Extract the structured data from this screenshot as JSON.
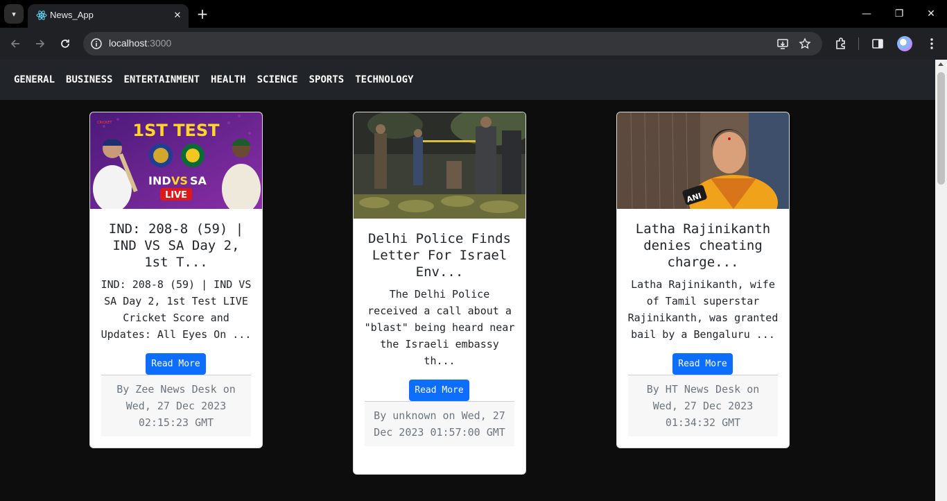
{
  "browser": {
    "tab_title": "News_App",
    "url_host": "localhost",
    "url_port": ":3000"
  },
  "nav": {
    "items": [
      "GENERAL",
      "BUSINESS",
      "ENTERTAINMENT",
      "HEALTH",
      "SCIENCE",
      "SPORTS",
      "TECHNOLOGY"
    ]
  },
  "articles": [
    {
      "title": "IND: 208-8 (59) | IND VS SA Day 2, 1st T...",
      "description": "IND: 208-8 (59) | IND VS SA Day 2, 1st Test LIVE Cricket Score and Updates: All Eyes On ...",
      "button": "Read More",
      "footer": "By Zee News Desk on Wed, 27 Dec 2023 02:15:23 GMT",
      "image": {
        "headline": "1ST TEST",
        "match_left": "IND",
        "match_vs": "VS",
        "match_right": "SA",
        "badge": "LIVE",
        "corner_logo": "CRICKET"
      }
    },
    {
      "title": "Delhi Police Finds Letter For Israel Env...",
      "description": "The Delhi Police received a call about a \"blast\" being heard near the Israeli embassy th...",
      "button": "Read More",
      "footer": "By unknown on Wed, 27 Dec 2023 01:57:00 GMT"
    },
    {
      "title": "Latha Rajinikanth denies cheating charge...",
      "description": "Latha Rajinikanth, wife of Tamil superstar Rajinikanth, was granted bail by a Bengaluru ...",
      "button": "Read More",
      "footer": "By HT News Desk on Wed, 27 Dec 2023 01:34:32 GMT",
      "image": {
        "mic_logo": "ANI"
      }
    }
  ]
}
